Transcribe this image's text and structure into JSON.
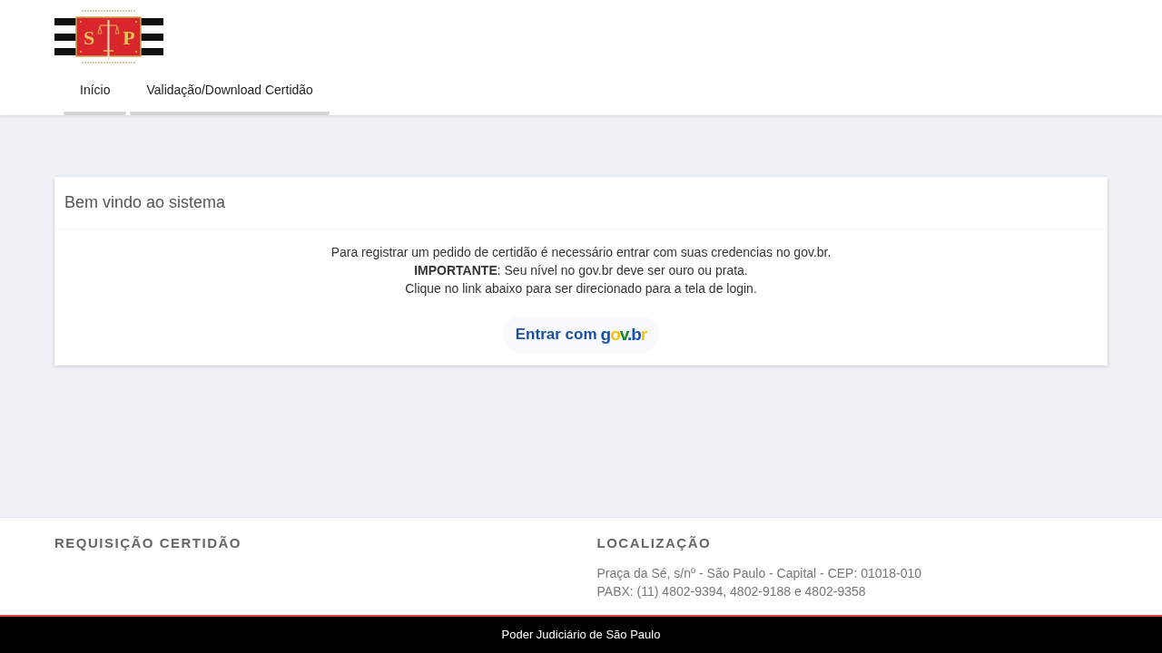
{
  "header": {
    "logo": {
      "letters": [
        "S",
        "P"
      ]
    },
    "nav": [
      {
        "label": "Início"
      },
      {
        "label": "Validação/Download Certidão"
      }
    ]
  },
  "card": {
    "title": "Bem vindo ao sistema",
    "lines": [
      "Para registrar um pedido de certidão é necessário entrar com suas credencias no gov.br.",
      "**IMPORTANTE**: Seu nível no gov.br deve ser ouro ou prata.",
      "Clique no link abaixo para ser direcionado para a tela de login."
    ],
    "button": {
      "label": "Entrar com",
      "logo": "gov.br"
    }
  },
  "footer": {
    "columns": [
      {
        "heading": "REQUISIÇÃO CERTIDÃO"
      },
      {
        "heading": "LOCALIZAÇÃO",
        "lines": [
          "Praça da Sé, s/nº - São Paulo - Capital - CEP: 01018-010",
          "PABX: (11) 4802-9394, 4802-9188 e 4802-9358"
        ]
      }
    ]
  },
  "bottom_bar": {
    "text": "Poder Judiciário de São Paulo"
  }
}
